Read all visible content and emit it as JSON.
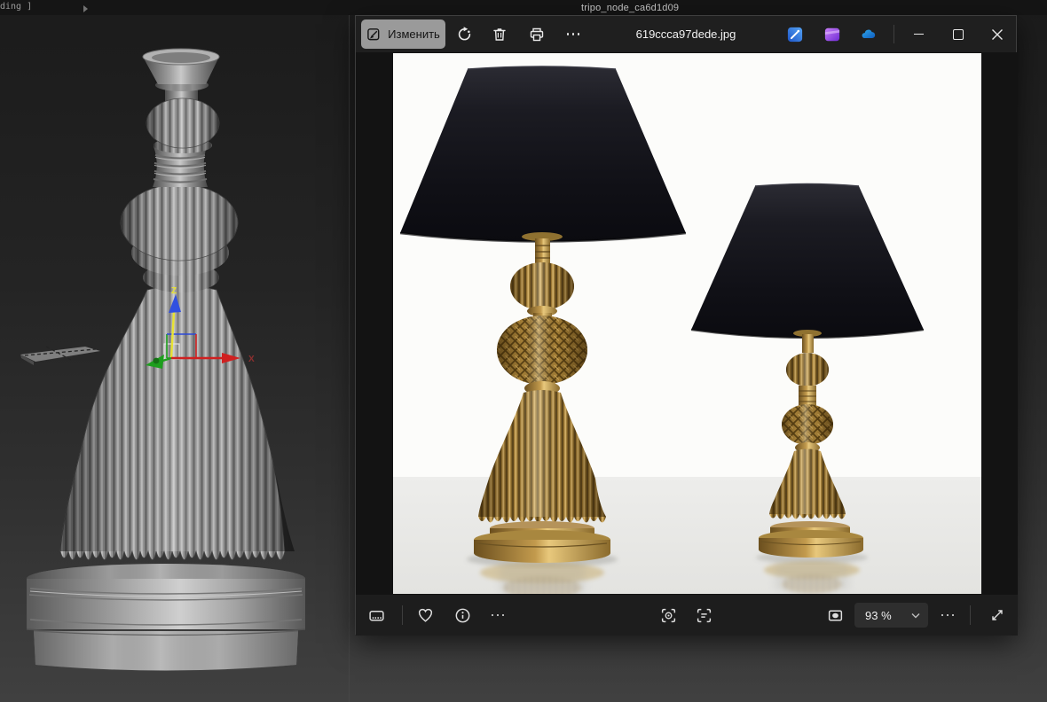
{
  "background_app": {
    "title": "tripo_node_ca6d1d09",
    "viewport_label_fragment": "ding ]",
    "gizmo": {
      "z_label": "Z",
      "x_label": "X",
      "z_shaft_color": "#e8e332",
      "z_head_color": "#3050e0",
      "x_color": "#d02020",
      "y_color": "#1d9e1d"
    },
    "viewport_colors": {
      "bg_top": "#1b1b1b",
      "bg_bottom": "#404040",
      "model_gray": "#989898"
    }
  },
  "photos_app": {
    "titlebar": {
      "edit_label": "Изменить",
      "filename": "619ccca97dede.jpg",
      "toolbar_icons": [
        "edit-icon",
        "rotate-icon",
        "delete-icon",
        "print-icon",
        "more-icon"
      ],
      "app_icons": [
        "designer-icon",
        "clipchamp-icon",
        "onedrive-icon"
      ],
      "window_controls": [
        "minimize",
        "maximize",
        "close"
      ]
    },
    "statusbar": {
      "zoom_level": "93 %",
      "left_icons": [
        "filmstrip-icon",
        "favorite-icon",
        "info-icon",
        "more-icon"
      ],
      "middle_icons": [
        "visual-search-icon",
        "text-actions-icon"
      ],
      "right_icons": [
        "zoom-fit-icon",
        "more-icon",
        "fullscreen-icon"
      ]
    },
    "colors": {
      "titlebar_bg": "#1f1f1f",
      "statusbar_bg": "#1d1d1d",
      "edit_button_bg": "#9a9a9a",
      "onedrive_blue": "#1493df",
      "designer_blue": "#2a6fe0",
      "clipchamp_purple": "#9a4ef0"
    },
    "photo_colors": {
      "background": "#fcfcfa",
      "floor": "#e9e9e6",
      "lamp_gold": "#9a7733",
      "shade_black": "#131318"
    }
  }
}
